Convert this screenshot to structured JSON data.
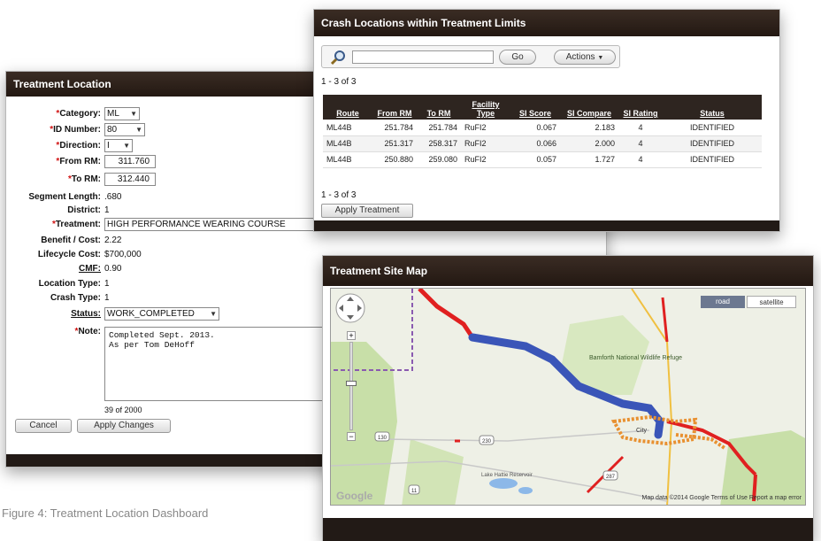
{
  "treatment_location": {
    "title": "Treatment Location",
    "category_label": "Category:",
    "category_value": "ML",
    "id_number_label": "ID Number:",
    "id_number_value": "80",
    "direction_label": "Direction:",
    "direction_value": "I",
    "from_rm_label": "From RM:",
    "from_rm_value": "311.760",
    "to_rm_label": "To RM:",
    "to_rm_value": "312.440",
    "segment_length_label": "Segment Length:",
    "segment_length_value": ".680",
    "district_label": "District:",
    "district_value": "1",
    "treatment_label": "Treatment:",
    "treatment_value": "HIGH PERFORMANCE WEARING COURSE",
    "benefit_cost_label": "Benefit / Cost:",
    "benefit_cost_value": "2.22",
    "lifecycle_cost_label": "Lifecycle Cost:",
    "lifecycle_cost_value": "$700,000",
    "cmf_label": "CMF:",
    "cmf_value": "0.90",
    "location_type_label": "Location Type:",
    "location_type_value": "1",
    "crash_type_label": "Crash Type:",
    "crash_type_value": "1",
    "status_label": "Status:",
    "status_value": "WORK_COMPLETED",
    "note_label": "Note:",
    "note_value": "Completed Sept. 2013.\nAs per Tom DeHoff",
    "char_count": "39 of 2000",
    "cancel_label": "Cancel",
    "apply_changes_label": "Apply Changes"
  },
  "crash_panel": {
    "title": "Crash Locations within Treatment Limits",
    "search_value": "",
    "go_label": "Go",
    "actions_label": "Actions",
    "range_top": "1 - 3 of 3",
    "range_bottom": "1 - 3 of 3",
    "apply_treatment_label": "Apply Treatment",
    "columns": [
      "Route",
      "From RM",
      "To RM",
      "Facility Type",
      "SI Score",
      "SI Compare",
      "SI Rating",
      "Status"
    ],
    "rows": [
      [
        "ML44B",
        "251.784",
        "251.784",
        "RuFI2",
        "0.067",
        "2.183",
        "4",
        "IDENTIFIED"
      ],
      [
        "ML44B",
        "251.317",
        "258.317",
        "RuFI2",
        "0.066",
        "2.000",
        "4",
        "IDENTIFIED"
      ],
      [
        "ML44B",
        "250.880",
        "259.080",
        "RuFI2",
        "0.057",
        "1.727",
        "4",
        "IDENTIFIED"
      ]
    ]
  },
  "map_panel": {
    "title": "Treatment Site Map",
    "map_type_road": "road",
    "map_type_satellite": "satellite",
    "refuge_label": "Bamforth National Wildlife Refuge",
    "city_label": "City",
    "lake_label": "Lake Hattie Reservoir",
    "shield_130": "130",
    "shield_230": "230",
    "shield_11": "11",
    "shield_287": "287",
    "google_logo": "Google",
    "attribution": "Map data ©2014 Google   Terms of Use   Report a map error",
    "colors": {
      "route_main": "#3a55b8",
      "route_alt": "#e02020",
      "crash_cluster": "#e89030",
      "land": "#eef0e6",
      "forest": "#c8dfa8",
      "water": "#8cb8e8"
    }
  },
  "caption": "Figure 4: Treatment Location Dashboard"
}
